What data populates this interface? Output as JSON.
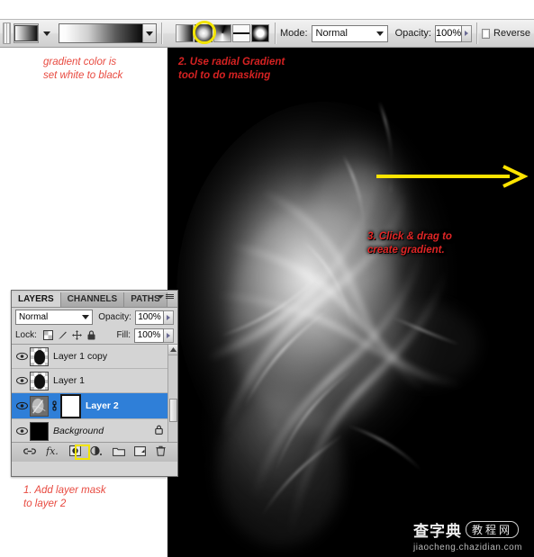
{
  "app": "Adobe Photoshop - Gradient tool tutorial",
  "options_bar": {
    "gradient_swatch_name": "gradient-preset-swatch",
    "gradient_preview_from": "#ffffff",
    "gradient_preview_to": "#000000",
    "gradient_types": [
      {
        "name": "linear-gradient-button",
        "label": "Linear Gradient",
        "selected": false
      },
      {
        "name": "radial-gradient-button",
        "label": "Radial Gradient",
        "selected": true
      },
      {
        "name": "angle-gradient-button",
        "label": "Angle Gradient",
        "selected": false
      },
      {
        "name": "reflected-gradient-button",
        "label": "Reflected Gradient",
        "selected": false
      },
      {
        "name": "diamond-gradient-button",
        "label": "Diamond Gradient",
        "selected": false
      }
    ],
    "mode_label": "Mode:",
    "mode_value": "Normal",
    "opacity_label": "Opacity:",
    "opacity_value": "100%",
    "reverse_label": "Reverse",
    "highlight_color": "#f2e400"
  },
  "annotations": {
    "a1": "gradient color is\nset white to black",
    "a2": "2. Use radial Gradient\ntool to do masking",
    "a3": "3. Click & drag to\ncreate gradient.",
    "a4": "1. Add layer mask\nto layer 2",
    "arrow_color": "#ffe400",
    "red_on_white": "#e8493f",
    "red_on_black": "#d62222"
  },
  "layers_panel": {
    "tabs": [
      {
        "label": "LAYERS",
        "active": true
      },
      {
        "label": "CHANNELS",
        "active": false
      },
      {
        "label": "PATHS",
        "active": false
      }
    ],
    "blend_mode": "Normal",
    "opacity_label": "Opacity:",
    "opacity_value": "100%",
    "lock_label": "Lock:",
    "fill_label": "Fill:",
    "fill_value": "100%",
    "selection_color": "#2f7fd8",
    "layers": [
      {
        "name": "Layer 1 copy",
        "visible": true,
        "selected": false,
        "italic": false,
        "locked": false,
        "has_mask": false,
        "thumb": "blob"
      },
      {
        "name": "Layer 1",
        "visible": true,
        "selected": false,
        "italic": false,
        "locked": false,
        "has_mask": false,
        "thumb": "blob"
      },
      {
        "name": "Layer 2",
        "visible": true,
        "selected": true,
        "italic": false,
        "locked": false,
        "has_mask": true,
        "thumb": "smoke"
      },
      {
        "name": "Background",
        "visible": true,
        "selected": false,
        "italic": true,
        "locked": true,
        "has_mask": false,
        "thumb": "black"
      }
    ],
    "footer_buttons": [
      {
        "name": "link-layers-button",
        "glyph": "link"
      },
      {
        "name": "layer-style-fx-button",
        "glyph": "fx"
      },
      {
        "name": "add-layer-mask-button",
        "glyph": "mask",
        "highlighted": true
      },
      {
        "name": "new-adjustment-layer-button",
        "glyph": "adjust"
      },
      {
        "name": "new-group-button",
        "glyph": "folder"
      },
      {
        "name": "new-layer-button",
        "glyph": "newlayer"
      },
      {
        "name": "delete-layer-button",
        "glyph": "trash"
      }
    ]
  },
  "watermark": {
    "cn": "查字典",
    "pill": "教程网",
    "url": "jiaocheng.chazidian.com"
  }
}
